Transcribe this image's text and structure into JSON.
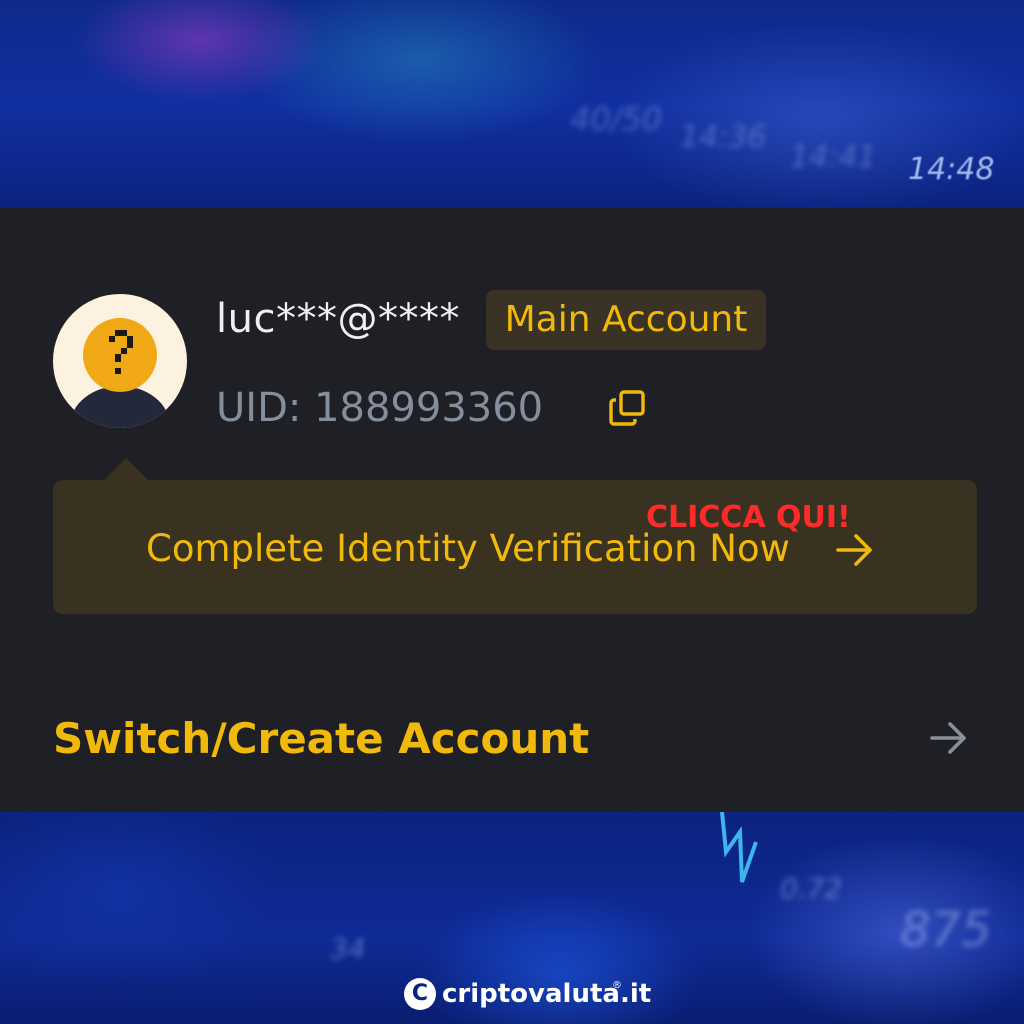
{
  "background": {
    "time_label": "14:48"
  },
  "account": {
    "email_masked": "luc***@****",
    "account_badge": "Main Account",
    "uid_text": "UID: 188993360"
  },
  "verification": {
    "prompt": "Complete Identity Verification Now",
    "overlay_annotation": "CLICCA QUI!"
  },
  "switch_account": {
    "label": "Switch/Create Account"
  },
  "watermark": {
    "brand": "criptovaluta.it",
    "registered_mark": "®",
    "logo_letter": "C"
  },
  "icons": {
    "copy": "copy-icon",
    "arrow": "arrow-right-icon",
    "avatar": "default-avatar-icon"
  },
  "colors": {
    "panel_bg": "#1e2026",
    "accent_yellow": "#f0b90b",
    "muted_gray": "#848e9c",
    "annotation_red": "#ff2b2b",
    "verify_box_bg": "#3a3220"
  }
}
